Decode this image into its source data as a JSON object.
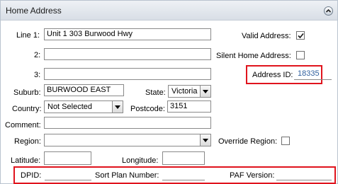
{
  "header": {
    "title": "Home Address"
  },
  "line1": {
    "label": "Line 1:",
    "value": "Unit 1 303 Burwood Hwy"
  },
  "line2": {
    "label": "2:",
    "value": ""
  },
  "line3": {
    "label": "3:",
    "value": ""
  },
  "valid_address": {
    "label": "Valid Address:",
    "checked": true
  },
  "silent_home_address": {
    "label": "Silent Home Address:",
    "checked": false
  },
  "address_id": {
    "label": "Address ID:",
    "value": "18335"
  },
  "suburb": {
    "label": "Suburb:",
    "value": "BURWOOD EAST"
  },
  "state": {
    "label": "State:",
    "value": "Victoria"
  },
  "country": {
    "label": "Country:",
    "value": "Not Selected"
  },
  "postcode": {
    "label": "Postcode:",
    "value": "3151"
  },
  "comment": {
    "label": "Comment:",
    "value": ""
  },
  "region": {
    "label": "Region:",
    "value": ""
  },
  "override_region": {
    "label": "Override Region:",
    "checked": false
  },
  "latitude": {
    "label": "Latitude:",
    "value": ""
  },
  "longitude": {
    "label": "Longitude:",
    "value": ""
  },
  "dpid": {
    "label": "DPID:"
  },
  "sort_plan_number": {
    "label": "Sort Plan Number:"
  },
  "paf_version": {
    "label": "PAF Version:"
  },
  "colors": {
    "highlight": "#e0141d",
    "address_id_text": "#2f5f9e"
  },
  "icons": {
    "collapse": "chevron-up-circle-icon",
    "checkmark": "check-icon"
  }
}
